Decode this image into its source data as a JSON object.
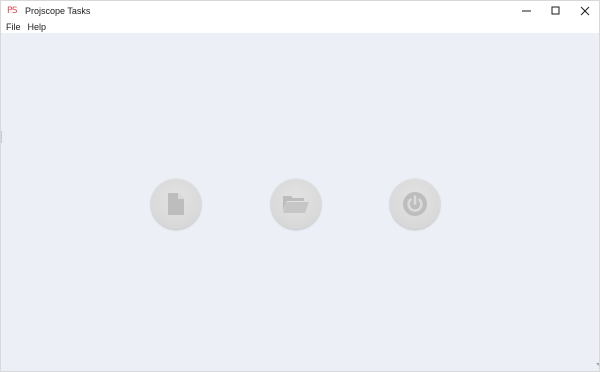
{
  "window": {
    "icon_text": "PS",
    "title": "Projscope Tasks"
  },
  "menu": {
    "items": [
      {
        "label": "File"
      },
      {
        "label": "Help"
      }
    ]
  },
  "actions": [
    {
      "name": "new-file",
      "icon": "file-icon"
    },
    {
      "name": "open-folder",
      "icon": "folder-open-icon"
    },
    {
      "name": "power",
      "icon": "power-icon"
    }
  ],
  "colors": {
    "client_background": "#ecf0f6",
    "button_face": "#dadada",
    "icon_color": "#bdbdbd",
    "app_icon": "#e8474c"
  }
}
